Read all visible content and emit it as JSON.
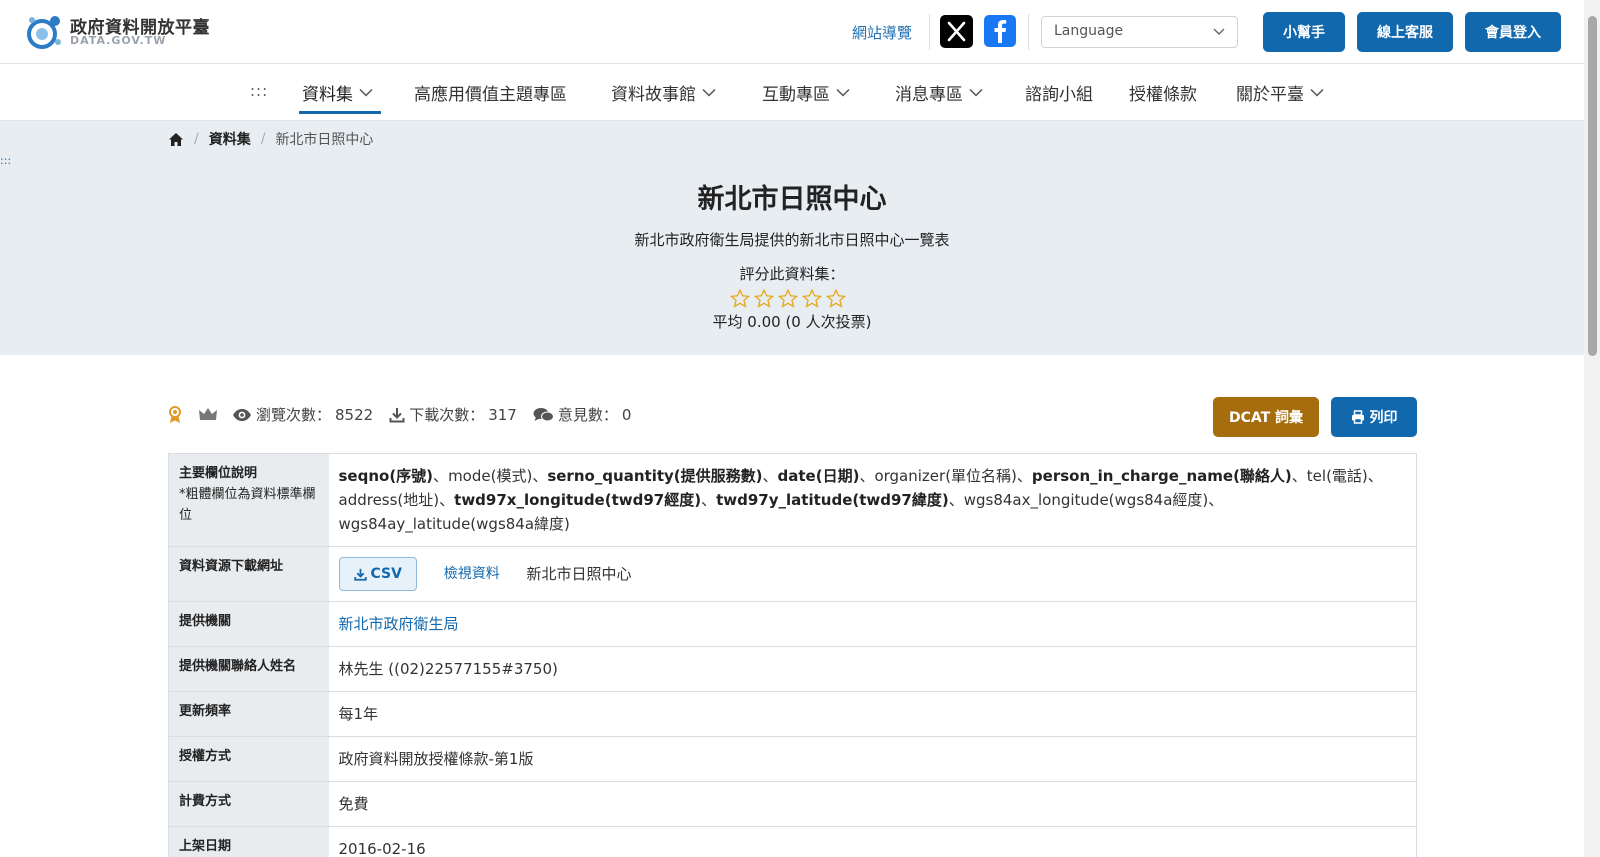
{
  "header": {
    "logo_title": "政府資料開放平臺",
    "logo_subtitle": "DATA.GOV.TW",
    "sitemap": "網站導覽",
    "language_placeholder": "Language",
    "helper_button": "小幫手",
    "support_button": "線上客服",
    "login_button": "會員登入",
    "x_icon": "x-logo-icon",
    "facebook_icon": "facebook-icon",
    "accent_color": "#1168ad"
  },
  "nav": {
    "skip": ":::",
    "items": [
      {
        "label": "資料集",
        "dropdown": true
      },
      {
        "label": "高應用價值主題專區",
        "dropdown": false
      },
      {
        "label": "資料故事館",
        "dropdown": true
      },
      {
        "label": "互動專區",
        "dropdown": true
      },
      {
        "label": "消息專區",
        "dropdown": true
      },
      {
        "label": "諮詢小組",
        "dropdown": false
      },
      {
        "label": "授權條款",
        "dropdown": false
      },
      {
        "label": "關於平臺",
        "dropdown": true
      }
    ]
  },
  "breadcrumb": {
    "home_icon": "home-icon",
    "level1": "資料集",
    "current": "新北市日照中心"
  },
  "hero": {
    "skip": ":::",
    "title": "新北市日照中心",
    "description": "新北市政府衛生局提供的新北市日照中心一覽表",
    "rate_label": "評分此資料集：",
    "rating": 0,
    "rating_max": 5,
    "average_text": "平均 0.00 (0 人次投票)"
  },
  "stats": {
    "views_label": "瀏覽次數：",
    "views": "8522",
    "downloads_label": "下載次數：",
    "downloads": "317",
    "comments_label": "意見數：",
    "comments": "0",
    "dcat_button": "DCAT 詞彙",
    "print_button": "列印"
  },
  "table": {
    "fields_label": "主要欄位說明",
    "fields_note": "*粗體欄位為資料標準欄位",
    "fields": [
      {
        "text": "seqno(序號)",
        "bold": true
      },
      {
        "text": "mode(模式)",
        "bold": false
      },
      {
        "text": "serno_quantity(提供服務數)",
        "bold": true
      },
      {
        "text": "date(日期)",
        "bold": true
      },
      {
        "text": "organizer(單位名稱)",
        "bold": false
      },
      {
        "text": "person_in_charge_name(聯絡人)",
        "bold": true
      },
      {
        "text": "tel(電話)",
        "bold": false
      },
      {
        "text": "address(地址)",
        "bold": false
      },
      {
        "text": "twd97x_longitude(twd97經度)",
        "bold": true
      },
      {
        "text": "twd97y_latitude(twd97緯度)",
        "bold": true
      },
      {
        "text": "wgs84ax_longitude(wgs84a經度)",
        "bold": false
      },
      {
        "text": "wgs84ay_latitude(wgs84a緯度)",
        "bold": false
      }
    ],
    "separator": "、",
    "download_label": "資料資源下載網址",
    "csv_button": "CSV",
    "view_data": "檢視資料",
    "resource_name": "新北市日照中心",
    "agency_label": "提供機關",
    "agency": "新北市政府衛生局",
    "contact_label": "提供機關聯絡人姓名",
    "contact": "林先生 ((02)22577155#3750)",
    "frequency_label": "更新頻率",
    "frequency": "每1年",
    "license_label": "授權方式",
    "license": "政府資料開放授權條款-第1版",
    "fee_label": "計費方式",
    "fee": "免費",
    "published_label": "上架日期",
    "published": "2016-02-16"
  }
}
